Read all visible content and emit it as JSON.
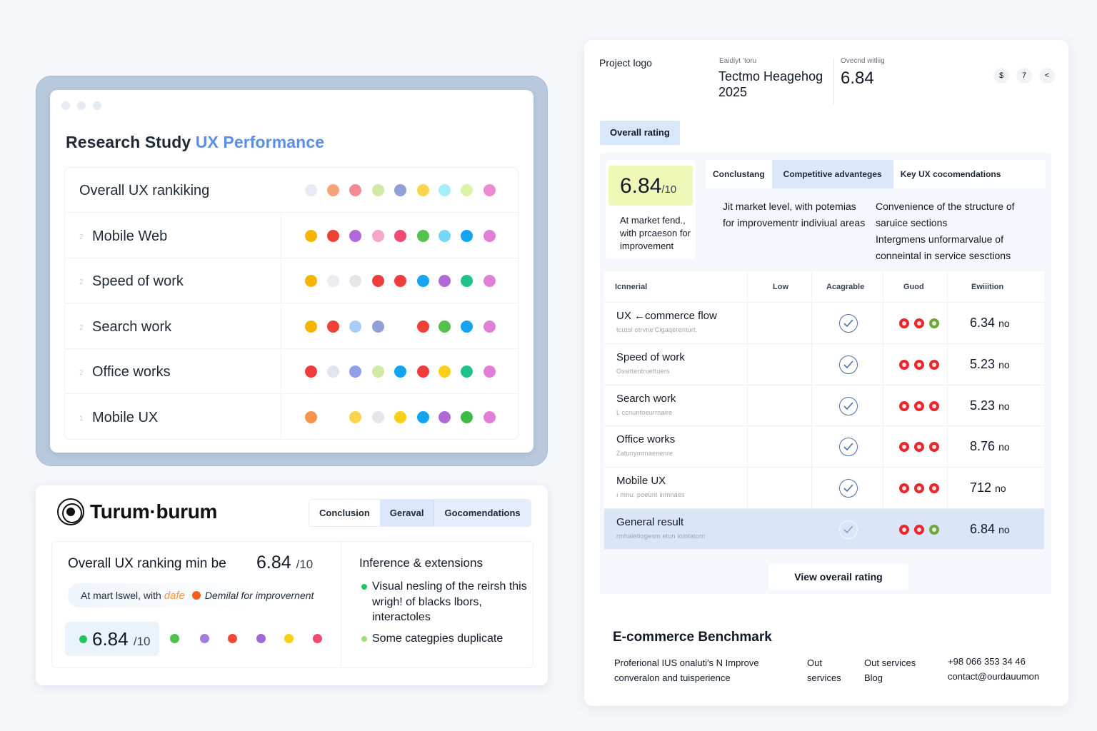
{
  "research": {
    "title_prefix": "Research Study",
    "title_accent": "UX Performance",
    "rows": [
      {
        "label": "Overall UX rankiking",
        "num": "",
        "dots": [
          "#e6ebf3",
          "#f6a27b",
          "#f48a93",
          "#cfeaa4",
          "#8f9fd8",
          "#fcd34d",
          "#a5eefc",
          "#d8f5a8",
          "#ec8ad0"
        ]
      },
      {
        "label": "Mobile Web",
        "num": "2",
        "dots": [
          "#f5b400",
          "#ef4136",
          "#b06ad8",
          "#f7a5c9",
          "#ef4a6f",
          "#52c24c",
          "#78d7f7",
          "#14a3ee",
          "#e17fd8"
        ]
      },
      {
        "label": "Speed of work",
        "num": "2",
        "dots": [
          "#f5b400",
          "#ececf0",
          "#e6e6ea",
          "#ef3d3d",
          "#ef3d3d",
          "#16a3ef",
          "#b06ad8",
          "#1fc38a",
          "#e17fd8"
        ]
      },
      {
        "label": "Search work",
        "num": "2",
        "dots": [
          "#f5b400",
          "#ef4136",
          "#a9cdfb",
          "#8f9fd8",
          "",
          "#ef4136",
          "#52c24c",
          "#14a3ee",
          "#e17fd8"
        ]
      },
      {
        "label": "Office works",
        "num": "2",
        "dots": [
          "#ef3d3d",
          "#dfe4f0",
          "#8f9fe8",
          "#cfeaa4",
          "#14a3ee",
          "#ef3d3d",
          "#f9cf17",
          "#1fc38a",
          "#e17fd8"
        ]
      },
      {
        "label": "Mobile UX",
        "num": "1",
        "dots": [
          "#f6954a",
          "",
          "#fcd34d",
          "#e6e6ea",
          "#f9cf17",
          "#14a3ee",
          "#b06ad8",
          "#3dbb45",
          "#e17fd8"
        ]
      }
    ]
  },
  "turum": {
    "brand": "Turum·burum",
    "tabs": [
      "Conclusion",
      "Geraval",
      "Gocomendations"
    ],
    "ranking_label": "Overall UX ranking min be",
    "score": "6.84",
    "score_denom": "/10",
    "sub_text_1": "At mart lswel, with ",
    "sub_text_accent": "dafe",
    "sub_text_2": "Demilal for improvernent",
    "chip_score": "6.84",
    "chip_denom": "/10",
    "chip_dots": [
      "#4cc24b",
      "#a07ee3",
      "#ef4a36",
      "#9d6ad8",
      "#f9cf17",
      "#ef4a6f"
    ],
    "right_title": "Inference & extensions",
    "bullets": [
      "Visual nesling of the reirsh this wrigh! of blacks lbors, interactoles",
      "Some categpies duplicate"
    ]
  },
  "dash": {
    "logo": "Project logo",
    "mid_label": "Eaidiyt ʻtoru",
    "mid_value": "Tectmo Heagehog 2025",
    "right_label": "Ovecnd witliig",
    "right_value": "6.84",
    "icons": [
      "$",
      "7",
      "<"
    ],
    "rating_pill": "Overall rating",
    "score": "6.84",
    "score_denom": "/10",
    "score_desc": "At market fend., with prcaeson for improvement",
    "tabs": [
      "Conclustang",
      "Competitive advanteges",
      "Key UX cocomendations"
    ],
    "conclusion_left": "Jit market level, with potemias for improvementr indiviual areas",
    "conclusion_right_1": "Convenience of the structure of saruice sections",
    "conclusion_right_2": "Intergmens unformarvalue of conneintal in service sesctions",
    "table_headers": [
      "Icnnerial",
      "Low",
      "Acagrable",
      "Guod",
      "Ewiiition"
    ],
    "rows": [
      {
        "name": "UX ←commerce flow",
        "sub": "tcuɪsl otrvne'Cigaqerenturt.",
        "dots": [
          "#e8282c",
          "#e8282c",
          "#6fa83a"
        ],
        "score": "6.34",
        "unit": "no"
      },
      {
        "name": "Speed of work",
        "sub": "Ossittentruettuers",
        "dots": [
          "#e8282c",
          "#e8282c",
          "#e8282c"
        ],
        "score": "5.23",
        "unit": "no"
      },
      {
        "name": "Search work",
        "sub": "L ccnuntoeurrnaire",
        "dots": [
          "#e8282c",
          "#e8282c",
          "#e8282c"
        ],
        "score": "5.23",
        "unit": "no"
      },
      {
        "name": "Office works",
        "sub": "Zatunymrnaenenre",
        "dots": [
          "#e8282c",
          "#e8282c",
          "#e8282c"
        ],
        "score": "8.76",
        "unit": "no"
      },
      {
        "name": "Mobile UX",
        "sub": "ı mnu: poeunt inmnaes",
        "dots": [
          "#e8282c",
          "#e8282c",
          "#e8282c"
        ],
        "score": "712",
        "unit": "no"
      },
      {
        "name": "General result",
        "sub": "rmhaletiogesm etun ioiotatorn",
        "dots": [
          "#e8282c",
          "#e8282c",
          "#6fa83a"
        ],
        "score": "6.84",
        "unit": "no"
      }
    ],
    "view_button": "View overail rating",
    "bench_title": "E-commerce Benchmark",
    "foot_col1": "Proferional IUS onaluti's N Improve converalon and tuisperience",
    "foot_col2": "Out services",
    "foot_col3": "Out services Blog",
    "foot_col4_phone": "+98 066 353 34 46",
    "foot_col4_email": "contact@ourdauumon"
  }
}
